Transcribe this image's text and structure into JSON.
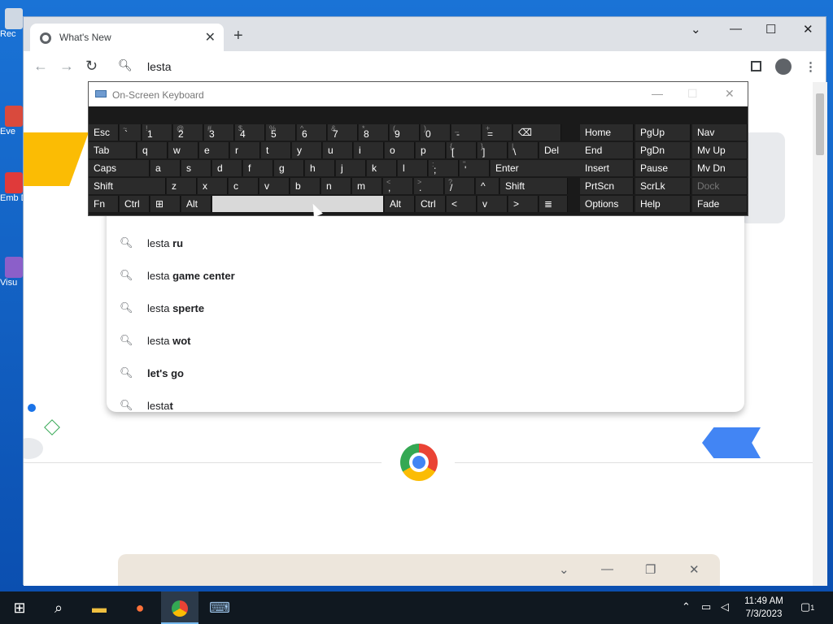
{
  "desktop": {
    "icons": [
      {
        "label": "Rec"
      },
      {
        "label": "Eve"
      },
      {
        "label": "Emb De"
      },
      {
        "label": "Visu"
      }
    ]
  },
  "browser": {
    "tab_title": "What's New",
    "tab_close": "✕",
    "new_tab": "+",
    "win_controls": {
      "dropdown": "⌄",
      "minimize": "—",
      "maximize": "☐",
      "close": "✕"
    },
    "back_icon": "←",
    "forward_icon": "→",
    "reload_icon": "↻",
    "omnibox_query": "lesta",
    "sidepanel_icon": "sidepanel-icon",
    "profile_icon": "profile-icon",
    "menu_icon": "⋮"
  },
  "suggestions": [
    {
      "plain": "lesta ",
      "bold": "ru"
    },
    {
      "plain": "lesta ",
      "bold": "game center"
    },
    {
      "plain": "lesta ",
      "bold": "sperte"
    },
    {
      "plain": "lesta ",
      "bold": "wot"
    },
    {
      "plain": "",
      "bold": "let's go"
    },
    {
      "plain": "lesta",
      "bold": "t"
    }
  ],
  "osk": {
    "title": "On-Screen Keyboard",
    "rows": [
      [
        {
          "m": "Esc"
        },
        {
          "s": "~",
          "m": "`"
        },
        {
          "s": "!",
          "m": "1"
        },
        {
          "s": "@",
          "m": "2"
        },
        {
          "s": "#",
          "m": "3"
        },
        {
          "s": "$",
          "m": "4"
        },
        {
          "s": "%",
          "m": "5"
        },
        {
          "s": "^",
          "m": "6"
        },
        {
          "s": "&",
          "m": "7"
        },
        {
          "s": "*",
          "m": "8"
        },
        {
          "s": "(",
          "m": "9"
        },
        {
          "s": ")",
          "m": "0"
        },
        {
          "s": "_",
          "m": "-"
        },
        {
          "s": "+",
          "m": "="
        },
        {
          "m": "⌫"
        }
      ],
      [
        {
          "m": "Tab"
        },
        {
          "m": "q"
        },
        {
          "m": "w"
        },
        {
          "m": "e"
        },
        {
          "m": "r"
        },
        {
          "m": "t"
        },
        {
          "m": "y"
        },
        {
          "m": "u"
        },
        {
          "m": "i"
        },
        {
          "m": "o"
        },
        {
          "m": "p"
        },
        {
          "s": "{",
          "m": "["
        },
        {
          "s": "}",
          "m": "]"
        },
        {
          "s": "|",
          "m": "\\"
        },
        {
          "m": "Del"
        }
      ],
      [
        {
          "m": "Caps"
        },
        {
          "m": "a"
        },
        {
          "m": "s"
        },
        {
          "m": "d"
        },
        {
          "m": "f"
        },
        {
          "m": "g"
        },
        {
          "m": "h"
        },
        {
          "m": "j"
        },
        {
          "m": "k"
        },
        {
          "m": "l"
        },
        {
          "s": ":",
          "m": ";"
        },
        {
          "s": "\"",
          "m": "'"
        },
        {
          "m": "Enter"
        }
      ],
      [
        {
          "m": "Shift"
        },
        {
          "m": "z"
        },
        {
          "m": "x"
        },
        {
          "m": "c"
        },
        {
          "m": "v"
        },
        {
          "m": "b"
        },
        {
          "m": "n"
        },
        {
          "m": "m"
        },
        {
          "s": "<",
          "m": ","
        },
        {
          "s": ">",
          "m": "."
        },
        {
          "s": "?",
          "m": "/"
        },
        {
          "m": "^"
        },
        {
          "m": "Shift"
        }
      ],
      [
        {
          "m": "Fn"
        },
        {
          "m": "Ctrl"
        },
        {
          "m": "⊞"
        },
        {
          "m": "Alt"
        },
        {
          "m": ""
        },
        {
          "m": "Alt"
        },
        {
          "m": "Ctrl"
        },
        {
          "m": "<"
        },
        {
          "m": "v"
        },
        {
          "m": ">"
        },
        {
          "m": "≣"
        }
      ]
    ],
    "nav": [
      [
        "Home",
        "PgUp",
        "Nav"
      ],
      [
        "End",
        "PgDn",
        "Mv Up"
      ],
      [
        "Insert",
        "Pause",
        "Mv Dn"
      ],
      [
        "PrtScn",
        "ScrLk",
        "Dock"
      ],
      [
        "Options",
        "Help",
        "Fade"
      ]
    ]
  },
  "taskbar": {
    "start_icon": "windows-icon",
    "search_icon": "search-icon",
    "time": "11:49 AM",
    "date": "7/3/2023",
    "notification_count": "1"
  }
}
